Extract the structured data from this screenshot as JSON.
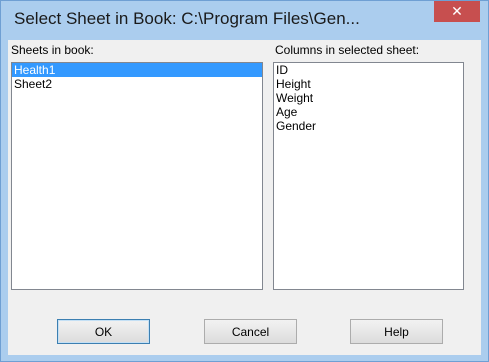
{
  "window": {
    "title": "Select Sheet in Book: C:\\Program Files\\Gen...",
    "close_glyph": "✕"
  },
  "sheets": {
    "label": "Sheets in book:",
    "items": [
      "Health1",
      "Sheet2"
    ],
    "selected": "Health1"
  },
  "columns": {
    "label": "Columns in selected sheet:",
    "items": [
      "ID",
      "Height",
      "Weight",
      "Age",
      "Gender"
    ]
  },
  "buttons": {
    "ok": "OK",
    "cancel": "Cancel",
    "help": "Help"
  },
  "colors": {
    "frame": "#abcdee",
    "close": "#c74f4f",
    "selection": "#3399ff"
  }
}
